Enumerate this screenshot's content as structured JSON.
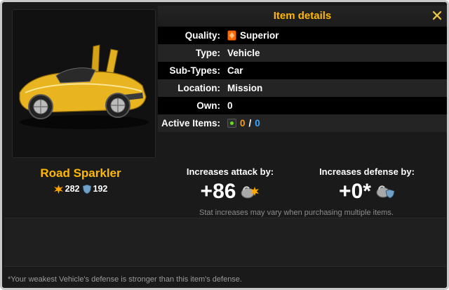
{
  "header": {
    "title": "Item details"
  },
  "details": {
    "rows": [
      {
        "label": "Quality:",
        "value": "Superior"
      },
      {
        "label": "Type:",
        "value": "Vehicle"
      },
      {
        "label": "Sub-Types:",
        "value": "Car"
      },
      {
        "label": "Location:",
        "value": "Mission"
      },
      {
        "label": "Own:",
        "value": "0"
      }
    ],
    "active_items": {
      "label": "Active Items:",
      "current": "0",
      "separator": "/",
      "max": "0"
    }
  },
  "item": {
    "name": "Road Sparkler",
    "attack": "282",
    "defense": "192"
  },
  "attack_increase": {
    "label": "Increases attack by:",
    "value": "+86"
  },
  "defense_increase": {
    "label": "Increases defense by:",
    "value": "+0*"
  },
  "note": "Stat increases may vary when purchasing multiple items.",
  "footer_note": "*Your weakest Vehicle's defense is stronger than this item's defense.",
  "colors": {
    "accent": "#ffb800",
    "quality_gem": "#ff6a00",
    "active_current": "#ff9d00",
    "active_max": "#3aa6ff"
  },
  "icons": [
    "close-icon",
    "quality-gem-icon",
    "active-item-icon",
    "attack-icon",
    "defense-icon",
    "attack-fist-icon",
    "defense-fist-icon"
  ]
}
